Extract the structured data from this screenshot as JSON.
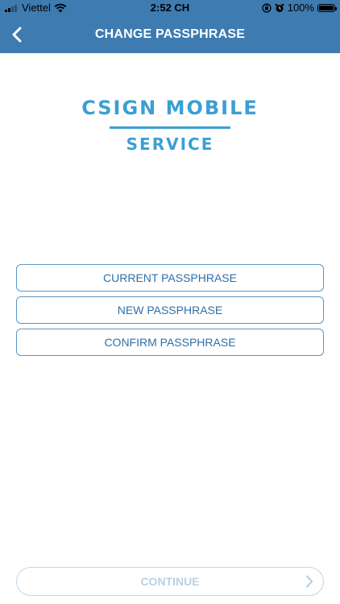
{
  "status_bar": {
    "carrier": "Viettel",
    "time": "2:52 CH",
    "battery_percent": "100%",
    "icons": [
      "signal-icon",
      "wifi-icon",
      "orientation-lock-icon",
      "alarm-icon",
      "battery-icon"
    ]
  },
  "nav": {
    "title": "CHANGE PASSPHRASE",
    "back_icon": "chevron-left-icon"
  },
  "logo": {
    "line1": "CSIGN MOBILE",
    "line2": "SERVICE"
  },
  "form": {
    "current_placeholder": "CURRENT PASSPHRASE",
    "current_value": "",
    "new_placeholder": "NEW PASSPHRASE",
    "new_value": "",
    "confirm_placeholder": "CONFIRM PASSPHRASE",
    "confirm_value": ""
  },
  "continue": {
    "label": "CONTINUE",
    "icon": "chevron-right-icon",
    "enabled": false
  },
  "colors": {
    "header_bg": "#3d7bb1",
    "accent": "#3b9fd4",
    "field_border": "#5b97c4",
    "field_text": "#2f6fa8",
    "disabled": "#b9cfe2"
  }
}
